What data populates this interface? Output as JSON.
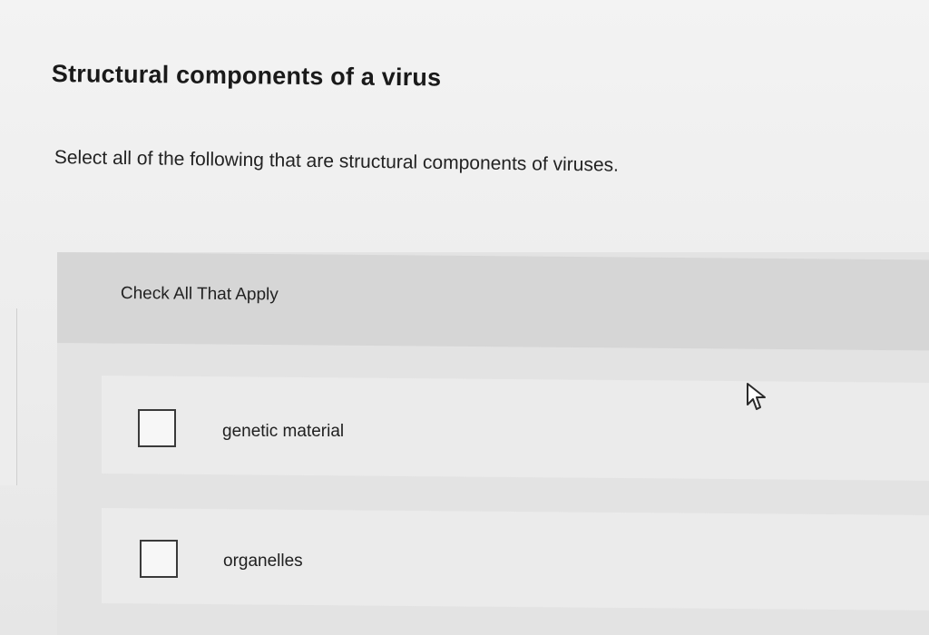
{
  "question": {
    "title": "Structural components of a virus",
    "prompt": "Select all of the following that are structural components of viruses."
  },
  "answers": {
    "instruction": "Check All That Apply",
    "options": [
      {
        "label": "genetic material",
        "checked": false
      },
      {
        "label": "organelles",
        "checked": false
      }
    ]
  },
  "icons": {
    "pointer": "mouse-pointer-icon"
  },
  "colors": {
    "text": "#1c1c1c",
    "instruction_bar": "#d6d6d6",
    "option_row": "#ebebeb",
    "checkbox_border": "#3a3a3a"
  }
}
